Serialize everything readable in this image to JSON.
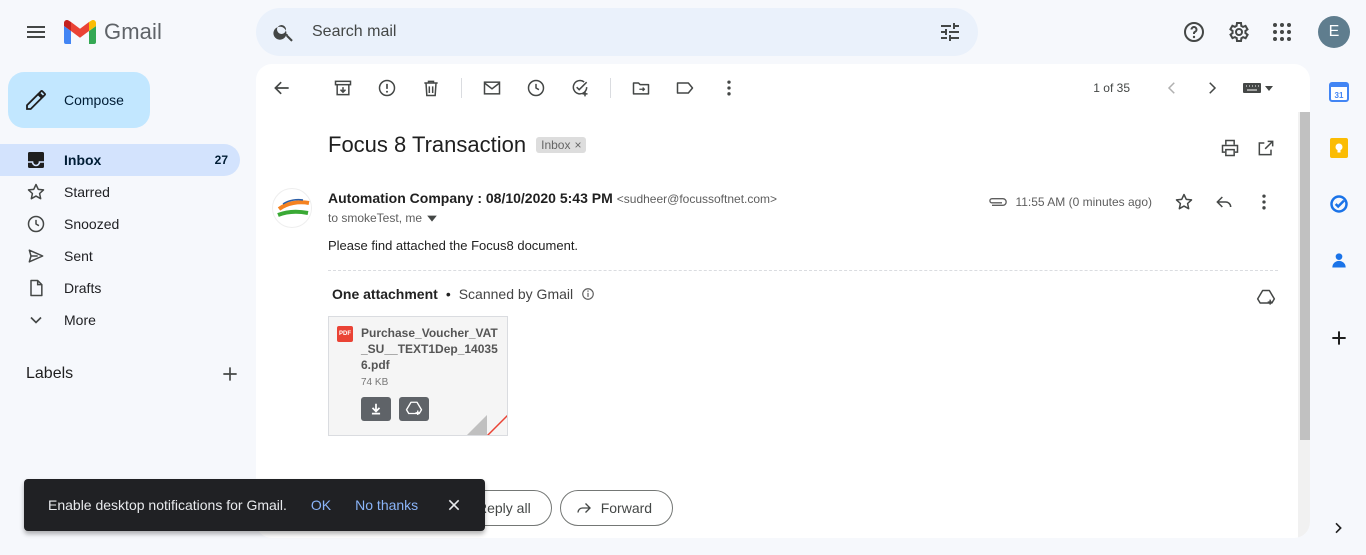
{
  "app": {
    "name": "Gmail",
    "avatar_letter": "E"
  },
  "search": {
    "placeholder": "Search mail"
  },
  "compose": {
    "label": "Compose"
  },
  "sidebar": {
    "items": [
      {
        "label": "Inbox",
        "count": "27",
        "icon": "inbox-icon",
        "active": true
      },
      {
        "label": "Starred",
        "count": "",
        "icon": "star-icon"
      },
      {
        "label": "Snoozed",
        "count": "",
        "icon": "clock-icon"
      },
      {
        "label": "Sent",
        "count": "",
        "icon": "send-icon"
      },
      {
        "label": "Drafts",
        "count": "",
        "icon": "draft-icon"
      },
      {
        "label": "More",
        "count": "",
        "icon": "chevron-down-icon"
      }
    ],
    "labels_title": "Labels"
  },
  "toolbar": {
    "pager": "1 of 35"
  },
  "email": {
    "subject": "Focus 8 Transaction",
    "label_badge": "Inbox",
    "sender_name": "Automation Company : 08/10/2020 5:43 PM",
    "sender_email": "<sudheer@focussoftnet.com>",
    "to": "to smokeTest, me",
    "time": "11:55 AM (0 minutes ago)",
    "body": "Please find attached the Focus8 document.",
    "attachments_title": "One attachment",
    "scanned": "Scanned by Gmail",
    "attachment": {
      "name": "Purchase_Voucher_VAT_SU__TEXT1Dep_140356.pdf",
      "size": "74 KB",
      "type_badge": "PDF"
    }
  },
  "reply": {
    "reply_all": "Reply all",
    "forward": "Forward"
  },
  "snackbar": {
    "text": "Enable desktop notifications for Gmail.",
    "ok": "OK",
    "no_thanks": "No thanks"
  },
  "colors": {
    "accent": "#0b57d0",
    "compose_bg": "#c2e7ff",
    "active_nav": "#d3e3fd",
    "background": "#f6f8fc"
  }
}
